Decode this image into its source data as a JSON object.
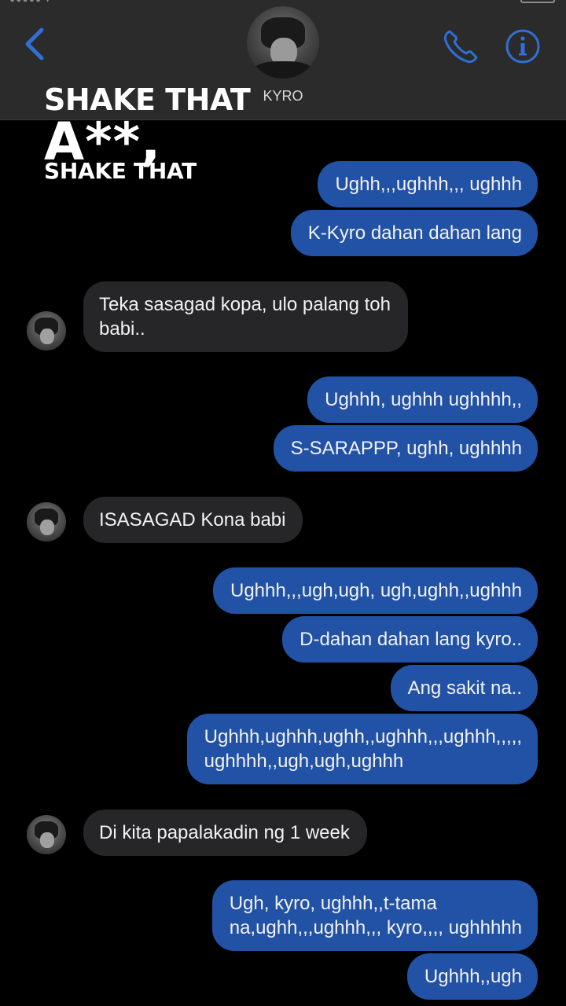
{
  "header": {
    "contact_name": "KYRO",
    "back_icon": "chevron-left-icon",
    "call_icon": "phone-icon",
    "info_icon": "info-icon",
    "accent_color": "#2f6fd6"
  },
  "overlay": {
    "line1": "SHAKE THAT",
    "line2": "A**,",
    "line3": "SHAKE THAT"
  },
  "messages": [
    {
      "from": "me",
      "text": "Ughh,,,ughhh,,, ughhh"
    },
    {
      "from": "me",
      "text": "K-Kyro dahan dahan lang"
    },
    {
      "from": "them",
      "line1": "Teka sasagad kopa, ulo palang toh",
      "line2": "babi.."
    },
    {
      "from": "me",
      "text": "Ughhh, ughhh ughhhh,,"
    },
    {
      "from": "me",
      "text": "S-SARAPPP, ughh, ughhhh"
    },
    {
      "from": "them",
      "text": "ISASAGAD Kona babi"
    },
    {
      "from": "me",
      "text": "Ughhh,,,ugh,ugh, ugh,ughh,,ughhh"
    },
    {
      "from": "me",
      "text": "D-dahan dahan lang kyro.."
    },
    {
      "from": "me",
      "text": "Ang sakit na.."
    },
    {
      "from": "me",
      "line1": "Ughhh,ughhh,ughh,,ughhh,,,ughhh,,,,,",
      "line2": "ughhhh,,ugh,ugh,ughhh"
    },
    {
      "from": "them",
      "text": "Di kita papalakadin ng 1 week"
    },
    {
      "from": "me",
      "line1": "Ugh, kyro, ughhh,,t-tama",
      "line2": "na,ughh,,,ughhh,,, kyro,,,, ughhhhh"
    },
    {
      "from": "me",
      "text": "Ughhh,,ugh"
    }
  ],
  "colors": {
    "outgoing_bubble": "#2252a6",
    "incoming_bubble": "#262628",
    "background": "#000000",
    "header_bg": "#2b2b2b"
  }
}
